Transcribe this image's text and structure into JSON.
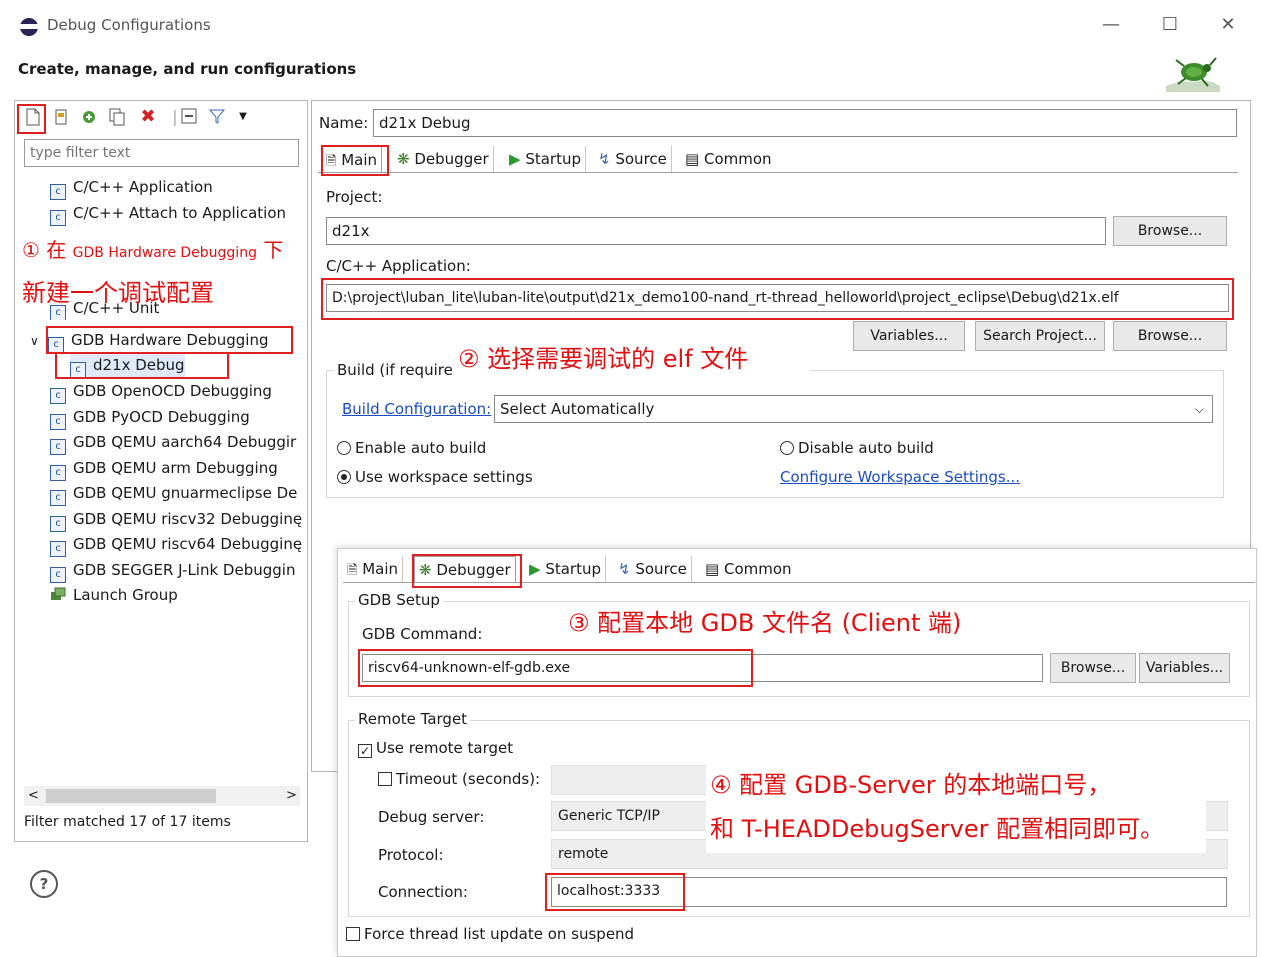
{
  "window": {
    "title": "Debug Configurations",
    "subtitle": "Create, manage, and run configurations",
    "controls": {
      "minimize": "—",
      "maximize": "☐",
      "close": "✕"
    }
  },
  "left": {
    "filter_placeholder": "type filter text",
    "tree": [
      {
        "label": "C/C++ Application",
        "icon": "c-icon"
      },
      {
        "label": "C/C++ Attach to Application",
        "icon": "c-icon"
      },
      {
        "label": "C/C++ Unit",
        "icon": "c-icon"
      },
      {
        "label": "GDB Hardware Debugging",
        "icon": "c-icon",
        "expanded": true
      },
      {
        "label": "d21x Debug",
        "icon": "c-icon",
        "selected": true
      },
      {
        "label": "GDB OpenOCD Debugging",
        "icon": "c-icon"
      },
      {
        "label": "GDB PyOCD Debugging",
        "icon": "c-icon"
      },
      {
        "label": "GDB QEMU aarch64 Debuggir",
        "icon": "c-icon"
      },
      {
        "label": "GDB QEMU arm Debugging",
        "icon": "c-icon"
      },
      {
        "label": "GDB QEMU gnuarmeclipse De",
        "icon": "c-icon"
      },
      {
        "label": "GDB QEMU riscv32 Debugginę",
        "icon": "c-icon"
      },
      {
        "label": "GDB QEMU riscv64 Debugginę",
        "icon": "c-icon"
      },
      {
        "label": "GDB SEGGER J-Link Debuggin",
        "icon": "c-icon"
      },
      {
        "label": "Launch Group",
        "icon": "launch-group-icon"
      }
    ],
    "expand_glyph": "∨",
    "scroll_left": "<",
    "scroll_right": ">",
    "status": "Filter matched 17 of 17 items",
    "help": "?"
  },
  "main": {
    "name_label": "Name:",
    "name_value": "d21x Debug",
    "tabs": [
      "Main",
      "Debugger",
      "Startup",
      "Source",
      "Common"
    ],
    "project_label": "Project:",
    "project_value": "d21x",
    "browse": "Browse...",
    "app_label": "C/C++ Application:",
    "app_value": "D:\\project\\luban_lite\\luban-lite\\output\\d21x_demo100-nand_rt-thread_helloworld\\project_eclipse\\Debug\\d21x.elf",
    "variables": "Variables...",
    "search_project": "Search Project...",
    "build_label": "Build (if require",
    "build_config_link": "Build Configuration:",
    "build_config_value": "Select Automatically",
    "enable_auto_build": "Enable auto build",
    "disable_auto_build": "Disable auto build",
    "use_workspace": "Use workspace settings",
    "configure_workspace": "Configure Workspace Settings..."
  },
  "debugger": {
    "tabs": [
      "Main",
      "Debugger",
      "Startup",
      "Source",
      "Common"
    ],
    "gdb_setup": "GDB Setup",
    "gdb_command_label": "GDB Command:",
    "gdb_command_value": "riscv64-unknown-elf-gdb.exe",
    "browse": "Browse...",
    "variables": "Variables...",
    "remote_target": "Remote Target",
    "use_remote": "Use remote target",
    "timeout": "Timeout (seconds):",
    "debug_server_label": "Debug server:",
    "debug_server_value": "Generic TCP/IP",
    "protocol_label": "Protocol:",
    "protocol_value": "remote",
    "connection_label": "Connection:",
    "connection_value": "localhost:3333",
    "force_thread": "Force thread list update on suspend"
  },
  "annotations": {
    "a1_num": "① 在",
    "a1_small": "GDB Hardware Debugging",
    "a1_end": "下",
    "a1_line2": "新建一个调试配置",
    "a2": "② 选择需要调试的 elf 文件",
    "a3": "③ 配置本地 GDB 文件名 (Client 端)",
    "a4_line1": "④ 配置 GDB-Server 的本地端口号，",
    "a4_line2": "和 T-HEADDebugServer 配置相同即可。"
  },
  "colors": {
    "annotation": "#e01010",
    "link": "#1a4ec0",
    "tree_icon": "#3060a0"
  }
}
